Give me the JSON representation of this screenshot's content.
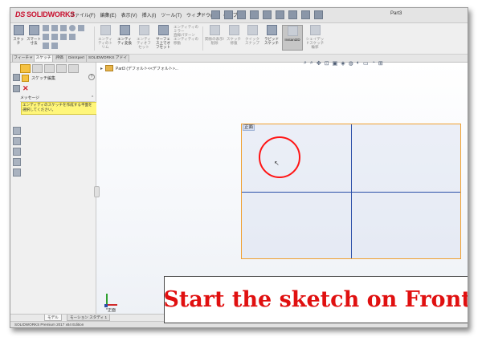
{
  "app": {
    "logo_brand": "SOLIDWORKS",
    "logo_prefix": "DS",
    "document_title": "Part3"
  },
  "menu": [
    "ファイル(F)",
    "編集(E)",
    "表示(V)",
    "挿入(I)",
    "ツール(T)",
    "ウィンドウ(W)",
    "ヘルプ(H)"
  ],
  "command_manager": {
    "tools": [
      {
        "label": "スケッチ",
        "state": "dark"
      },
      {
        "label": "スマート寸法",
        "state": "dark"
      },
      {
        "label": "エンティティのトリム",
        "state": "dim"
      },
      {
        "label": "エンティティ変換",
        "state": "dark"
      },
      {
        "label": "エンティティオフセット",
        "state": "dim"
      },
      {
        "label": "サーフェス上でオフセット",
        "state": "dark"
      },
      {
        "label": "エンティティのミラー",
        "state": "dim"
      },
      {
        "label": "直線パターン",
        "state": "dim"
      },
      {
        "label": "エンティティの移動",
        "state": "dim"
      },
      {
        "label": "関係の表示/削除",
        "state": "dim"
      },
      {
        "label": "スケッチ修復",
        "state": "dim"
      },
      {
        "label": "クイックスナップ",
        "state": "dim"
      },
      {
        "label": "ラピッドスケッチ",
        "state": "dark"
      },
      {
        "label": "Instant2D",
        "state": "active"
      },
      {
        "label": "シェイデッドスケッチ輪郭",
        "state": "dim"
      }
    ]
  },
  "tabs": [
    {
      "label": "フィーチャー",
      "active": false
    },
    {
      "label": "スケッチ",
      "active": true
    },
    {
      "label": "評価",
      "active": false
    },
    {
      "label": "DimXpert",
      "active": false
    },
    {
      "label": "SOLIDWORKS アドイン",
      "active": false
    }
  ],
  "property_manager": {
    "title": "スケッチ編集",
    "help": "?",
    "close_glyph": "✕",
    "message_header": "メッセージ",
    "message_chevron": "⌃",
    "message_body": "エンティティのスケッチを作成する平面を選択してください。"
  },
  "feature_tree": {
    "expand_glyph": "▸",
    "part_label": "Part3 (デフォルト<<デフォルト>..."
  },
  "hud_icons": [
    "⌕",
    "⌕",
    "✥",
    "⊡",
    "▣",
    "◈",
    "◍",
    "◐",
    "▭",
    "◔",
    "⊞"
  ],
  "graphics": {
    "plane_label": "正面",
    "cursor_glyph": "↖"
  },
  "caption": "Start the sketch on Front",
  "view_label": "*正面",
  "model_tabs": [
    {
      "label": "モデル",
      "active": true
    },
    {
      "label": "モーション スタディ 1",
      "active": false
    }
  ],
  "status": "SOLIDWORKS Premium 2017 x64 Edition",
  "colors": {
    "accent_red": "#e01010",
    "plane_border": "#f0a030",
    "axis_blue": "#2b4fa8",
    "message_bg": "#fff67a"
  }
}
